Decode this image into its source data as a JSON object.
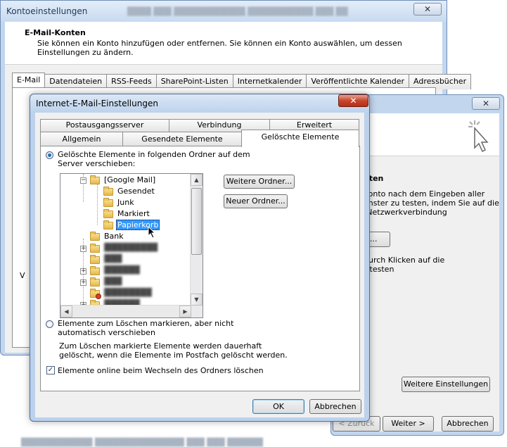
{
  "back_window": {
    "title": "Kontoeinstellungen",
    "close_label": "✕",
    "header_title": "E-Mail-Konten",
    "header_desc": "Sie können ein Konto hinzufügen oder entfernen. Sie können ein Konto auswählen, um dessen Einstellungen zu ändern.",
    "tabs": [
      "E-Mail",
      "Datendateien",
      "RSS-Feeds",
      "SharePoint-Listen",
      "Internetkalender",
      "Veröffentlichte Kalender",
      "Adressbücher"
    ],
    "left_fragment": "V"
  },
  "right_window": {
    "close_label": "✕",
    "heading": "nten",
    "text1": "Konto nach dem Eingeben aller",
    "text2": "enster zu testen, indem Sie auf die",
    "text3": "(Netzwerkverbindung",
    "button_partial": "n ...",
    "text4": "durch Klicken auf die",
    "text5": "\" testen",
    "more_settings_label": "Weitere Einstellungen",
    "back_label": "< Zurück",
    "next_label": "Weiter >",
    "cancel_label": "Abbrechen"
  },
  "dialog": {
    "title": "Internet-E-Mail-Einstellungen",
    "close_label": "✕",
    "tabs_row1": [
      "Postausgangsserver",
      "Verbindung",
      "Erweitert"
    ],
    "tabs_row2": [
      "Allgemein",
      "Gesendete Elemente",
      "Gelöschte Elemente"
    ],
    "radio_server_label": "Gelöschte Elemente in folgenden Ordner auf dem Server verschieben:",
    "more_folders_label": "Weitere Ordner...",
    "new_folder_label": "Neuer Ordner...",
    "tree": {
      "root": "[Google Mail]",
      "children": [
        "Gesendet",
        "Junk",
        "Markiert",
        "Papierkorb"
      ],
      "bank": "Bank"
    },
    "radio_mark_label": "Elemente zum Löschen markieren, aber nicht automatisch verschieben",
    "mark_desc": "Zum Löschen markierte Elemente werden dauerhaft gelöscht, wenn die Elemente im Postfach gelöscht werden.",
    "checkbox_label": "Elemente online beim Wechseln des Ordners löschen",
    "ok_label": "OK",
    "cancel_label": "Abbrechen"
  }
}
